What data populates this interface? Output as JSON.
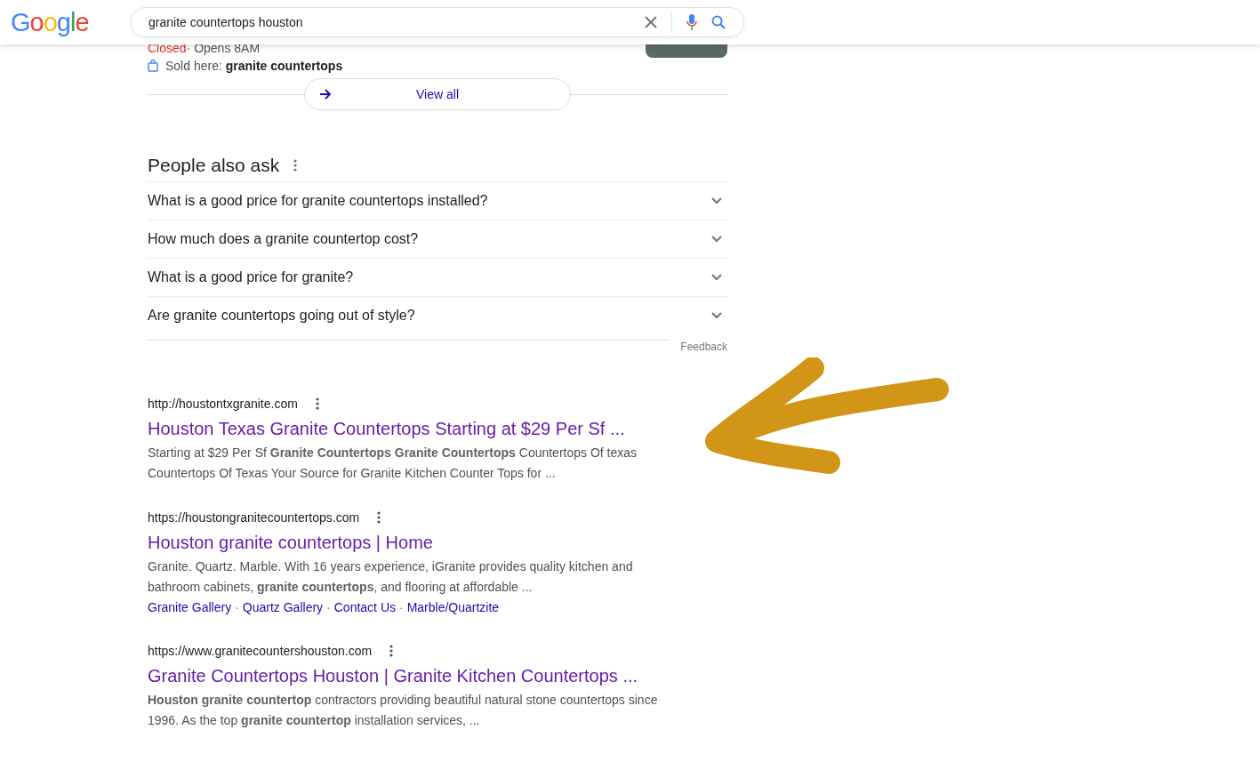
{
  "header": {
    "logo": "Google",
    "search": {
      "value": "granite countertops houston"
    }
  },
  "local_result": {
    "status": "Closed",
    "hours": "· Opens 8AM",
    "sold_here_label": "Sold here: ",
    "sold_here_value": "granite countertops",
    "view_all": "View all"
  },
  "people_also_ask": {
    "title": "People also ask",
    "questions": [
      {
        "text": "What is a good price for granite countertops installed?",
        "expanded": false
      },
      {
        "text": "How much does a granite countertop cost?",
        "expanded": false
      },
      {
        "text": "What is a good price for granite?",
        "expanded": false
      },
      {
        "text": "Are granite countertops going out of style?",
        "expanded": false
      }
    ],
    "feedback": "Feedback"
  },
  "results": [
    {
      "url": "http://houstontxgranite.com",
      "title": "Houston Texas Granite Countertops Starting at $29 Per Sf ...",
      "snippet": "Starting at $29 Per Sf **Granite Countertops Granite Countertops** Countertops Of texas Countertops Of Texas Your Source for Granite Kitchen Counter Tops for ..."
    },
    {
      "url": "https://houstongranitecountertops.com",
      "title": "Houston granite countertops | Home",
      "snippet": "Granite. Quartz. Marble. With 16 years experience, iGranite provides quality kitchen and bathroom cabinets, **granite countertops**, and flooring at affordable ...",
      "sitelinks": [
        "Granite Gallery",
        "Quartz Gallery",
        "Contact Us",
        "Marble/Quartzite"
      ],
      "sitelink_separator": "·"
    },
    {
      "url": "https://www.granitecountershouston.com",
      "title": "Granite Countertops Houston | Granite Kitchen Countertops ...",
      "snippet": "**Houston granite countertop** contractors providing beautiful natural stone countertops since 1996. As the top **granite countertop** installation services, ..."
    }
  ]
}
